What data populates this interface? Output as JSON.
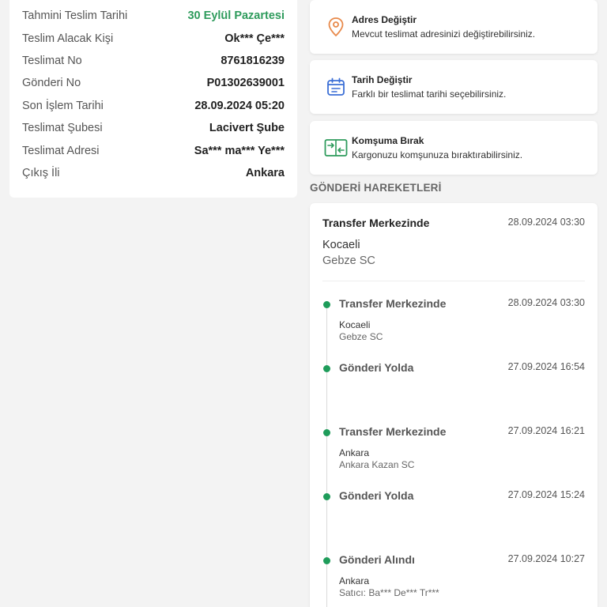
{
  "delivery_info": {
    "rows": [
      {
        "label": "Tahmini Teslim Tarihi",
        "value": "30 Eylül Pazartesi"
      },
      {
        "label": "Teslim Alacak Kişi",
        "value": "Ok*** Çe***"
      },
      {
        "label": "Teslimat No",
        "value": "8761816239"
      },
      {
        "label": "Gönderi No",
        "value": "P01302639001"
      },
      {
        "label": "Son İşlem Tarihi",
        "value": "28.09.2024 05:20"
      },
      {
        "label": "Teslimat Şubesi",
        "value": "Lacivert Şube"
      },
      {
        "label": "Teslimat Adresi",
        "value": "Sa*** ma*** Ye***"
      },
      {
        "label": "Çıkış İli",
        "value": "Ankara"
      }
    ],
    "highlight_color": "#2e9b5c"
  },
  "actions": [
    {
      "icon": "location-pin-icon",
      "title": "Adres Değiştir",
      "description": "Mevcut teslimat adresinizi değiştirebilirsiniz.",
      "color": "#e8894a"
    },
    {
      "icon": "calendar-icon",
      "title": "Tarih Değiştir",
      "description": "Farklı bir teslimat tarihi seçebilirsiniz.",
      "color": "#3b6fd6"
    },
    {
      "icon": "neighbor-transfer-icon",
      "title": "Komşuma Bırak",
      "description": "Kargonuzu komşunuza bıraktırabilirsiniz.",
      "color": "#2e9b5c"
    }
  ],
  "movements": {
    "section_title": "GÖNDERİ HAREKETLERİ",
    "latest": {
      "status": "Transfer Merkezinde",
      "time": "28.09.2024 03:30",
      "city": "Kocaeli",
      "branch": "Gebze SC"
    },
    "events": [
      {
        "status": "Transfer Merkezinde",
        "time": "28.09.2024 03:30",
        "city": "Kocaeli",
        "branch": "Gebze SC"
      },
      {
        "status": "Gönderi Yolda",
        "time": "27.09.2024 16:54",
        "city": "",
        "branch": ""
      },
      {
        "status": "Transfer Merkezinde",
        "time": "27.09.2024 16:21",
        "city": "Ankara",
        "branch": "Ankara Kazan SC"
      },
      {
        "status": "Gönderi Yolda",
        "time": "27.09.2024 15:24",
        "city": "",
        "branch": ""
      },
      {
        "status": "Gönderi Alındı",
        "time": "27.09.2024 10:27",
        "city": "Ankara",
        "branch": "Satıcı: Ba*** De*** Tr***"
      }
    ],
    "dot_color": "#1e9c5a"
  }
}
